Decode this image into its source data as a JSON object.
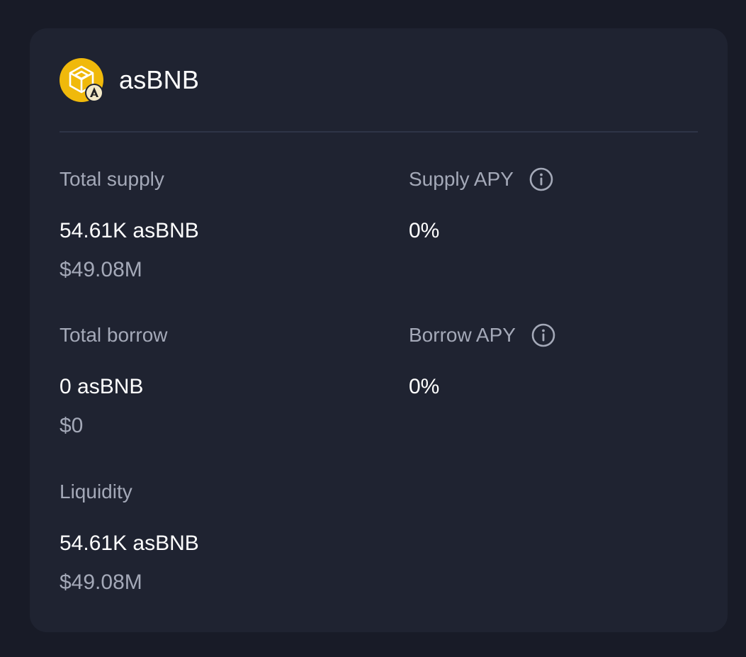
{
  "token": {
    "name": "asBNB",
    "icon": "bnb-cube-icon",
    "badge_icon": "astherus-badge-icon",
    "brand_color": "#f0b90b"
  },
  "stats": {
    "total_supply": {
      "label": "Total supply",
      "amount": "54.61K asBNB",
      "usd": "$49.08M"
    },
    "supply_apy": {
      "label": "Supply APY",
      "value": "0%",
      "icon": "info-icon"
    },
    "total_borrow": {
      "label": "Total borrow",
      "amount": "0 asBNB",
      "usd": "$0"
    },
    "borrow_apy": {
      "label": "Borrow APY",
      "value": "0%",
      "icon": "info-icon"
    },
    "liquidity": {
      "label": "Liquidity",
      "amount": "54.61K asBNB",
      "usd": "$49.08M"
    }
  },
  "colors": {
    "page_bg": "#181b27",
    "card_bg": "#1f2331",
    "label": "#a4a9b8",
    "value": "#ffffff"
  }
}
